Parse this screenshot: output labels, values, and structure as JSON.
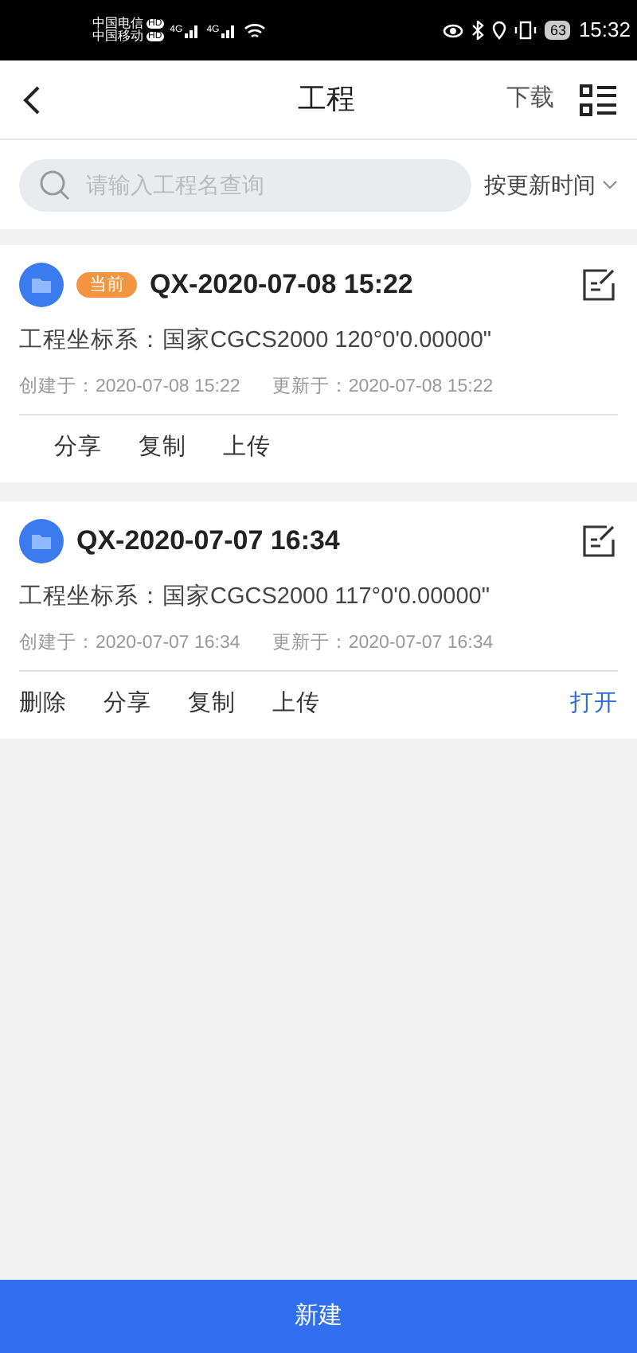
{
  "status_bar": {
    "carriers": [
      {
        "name": "中国电信",
        "badge": "HD",
        "network": "4G"
      },
      {
        "name": "中国移动",
        "badge": "HD",
        "network": "4G"
      }
    ],
    "battery": "63",
    "time": "15:32"
  },
  "header": {
    "title": "工程",
    "download": "下载"
  },
  "search": {
    "placeholder": "请输入工程名查询"
  },
  "sort": {
    "label": "按更新时间"
  },
  "projects": [
    {
      "current": true,
      "badge": "当前",
      "name": "QX-2020-07-08 15:22",
      "crs": "工程坐标系：国家CGCS2000  120°0'0.00000\"",
      "created": "创建于：2020-07-08 15:22",
      "updated": "更新于：2020-07-08 15:22",
      "actions": [
        "分享",
        "复制",
        "上传"
      ]
    },
    {
      "current": false,
      "name": "QX-2020-07-07 16:34",
      "crs": "工程坐标系：国家CGCS2000  117°0'0.00000\"",
      "created": "创建于：2020-07-07 16:34",
      "updated": "更新于：2020-07-07 16:34",
      "actions": [
        "删除",
        "分享",
        "复制",
        "上传"
      ],
      "open": "打开"
    }
  ],
  "new_button": "新建"
}
